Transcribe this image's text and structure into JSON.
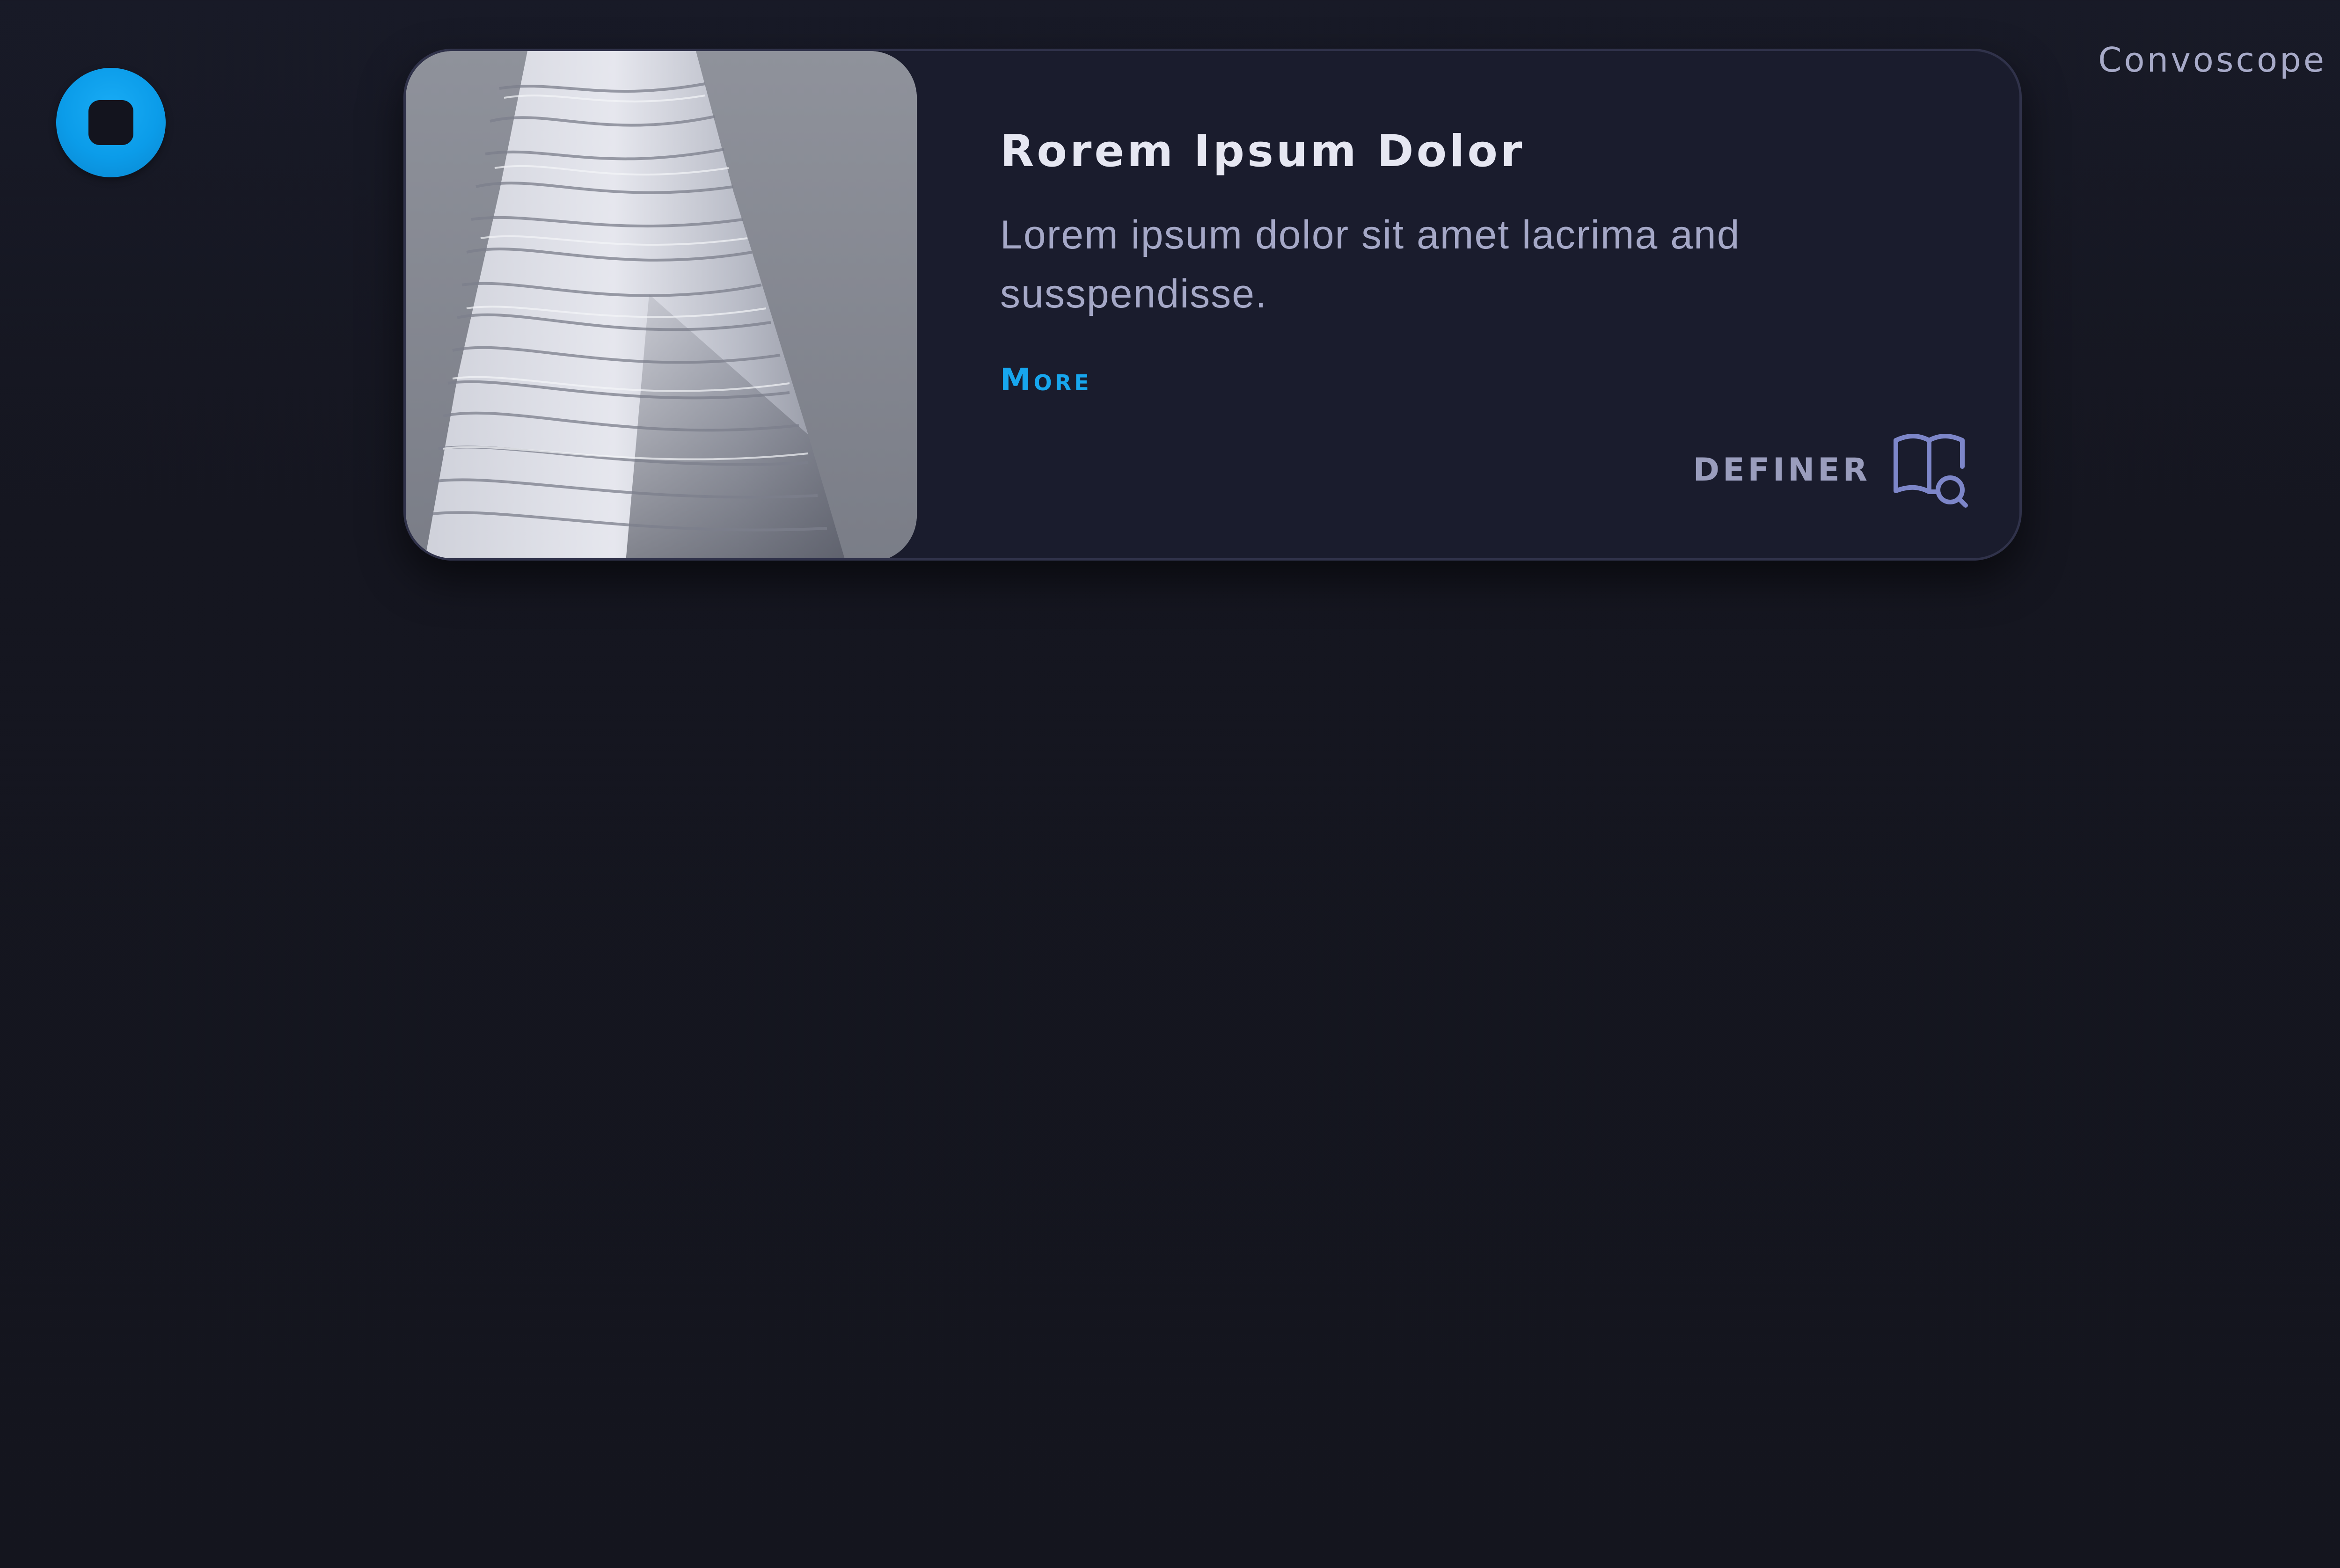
{
  "app": {
    "brand": "Convoscope"
  },
  "card": {
    "title": "Rorem Ipsum Dolor",
    "description": "Lorem ipsum dolor sit amet lacrima and susspendisse.",
    "more_label": "More",
    "definer_label": "DEFINER",
    "image": "building-photo",
    "icons": {
      "definer": "book-search-icon",
      "app_button": "stop-icon"
    }
  },
  "colors": {
    "background": "#15161f",
    "card_background": "#1a1c2d",
    "accent": "#17a6ee",
    "title": "#e6e7f2",
    "body_text": "#a5a8c7",
    "definer_icon": "#7d86c9"
  }
}
